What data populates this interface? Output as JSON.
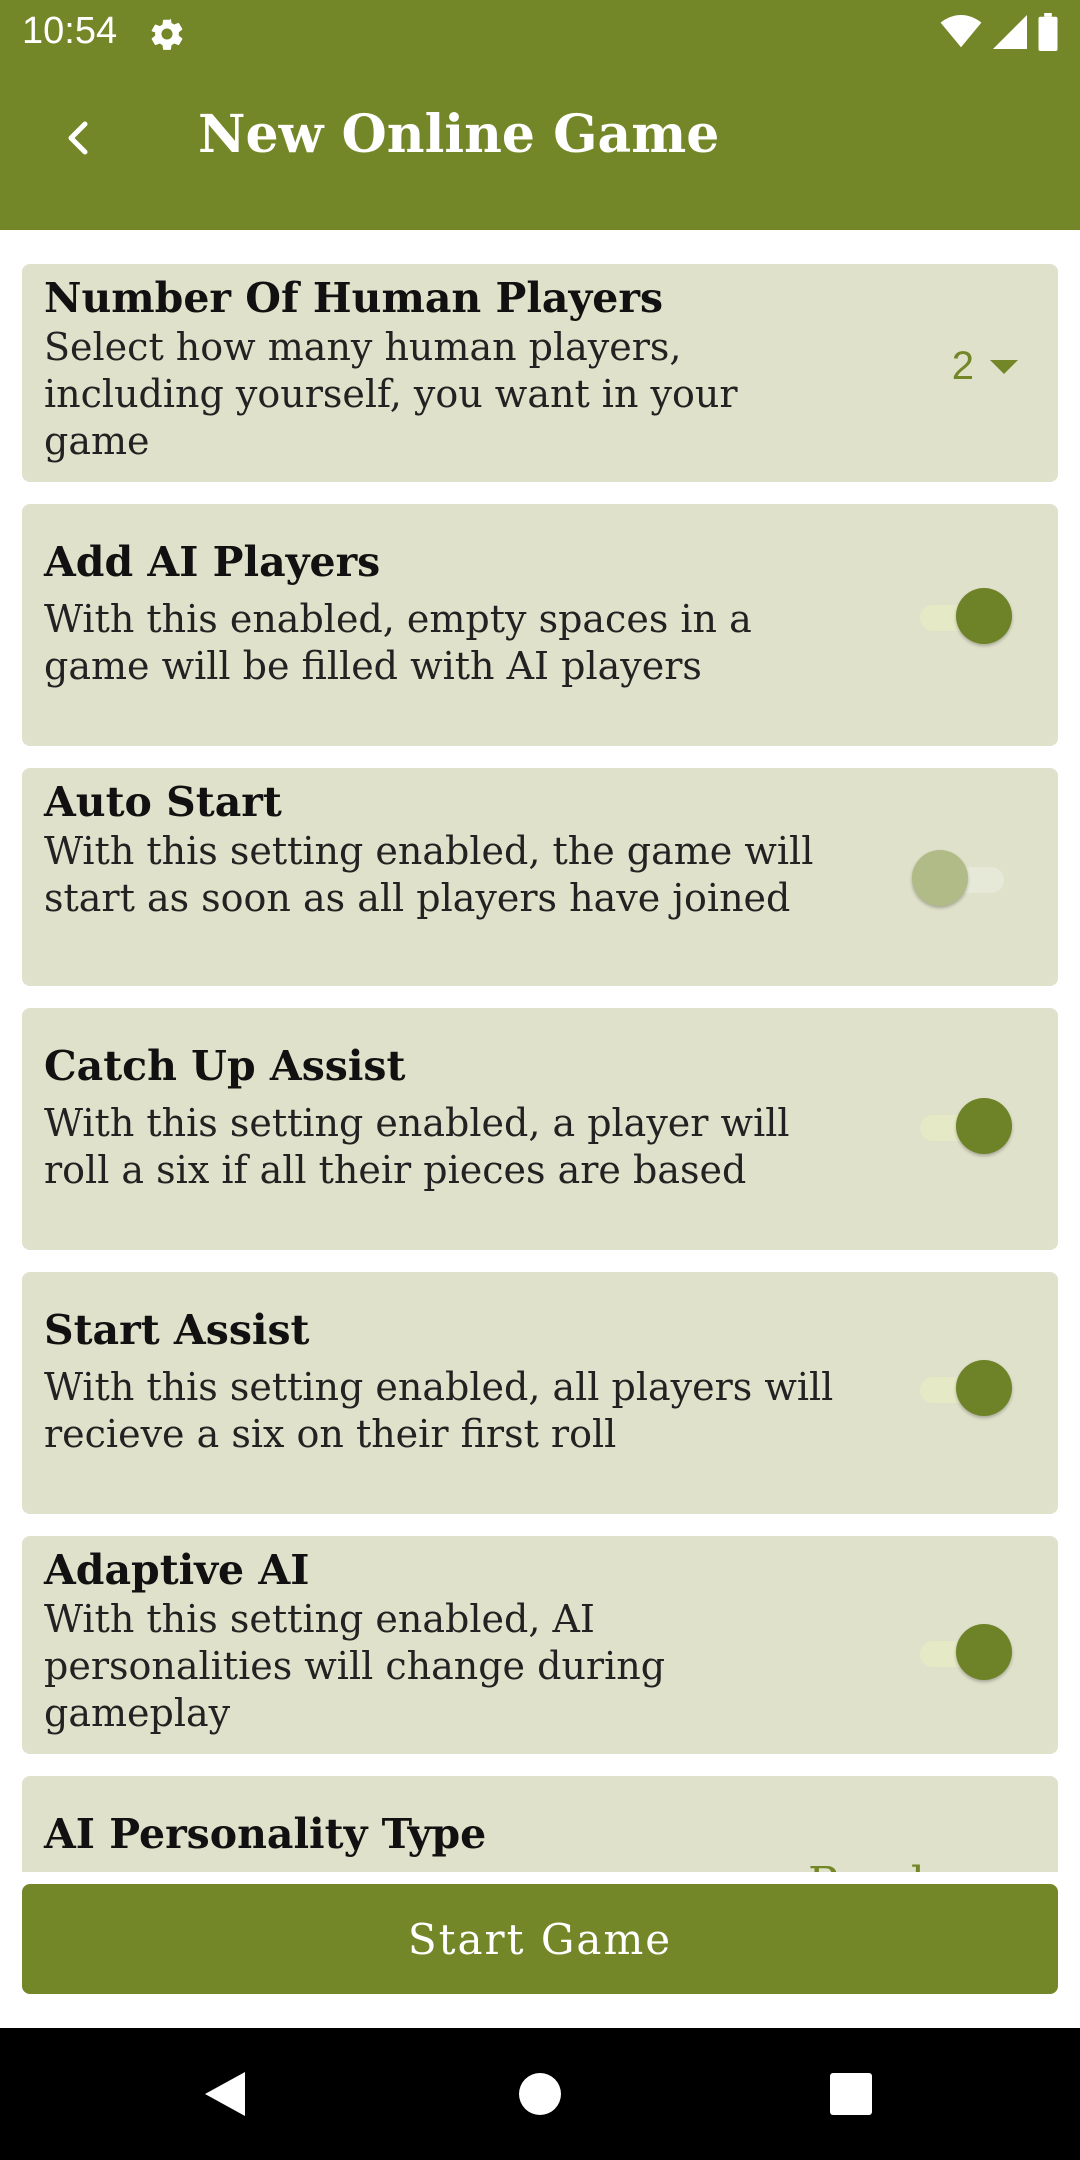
{
  "status_bar": {
    "time": "10:54",
    "icons": [
      "settings-gear-icon",
      "wifi-icon",
      "cellular-signal-icon",
      "battery-icon"
    ]
  },
  "app_bar": {
    "title": "New Online Game",
    "back_icon": "chevron-left-icon",
    "color": "#738728"
  },
  "settings": {
    "human_players": {
      "title": "Number Of Human Players",
      "description": "Select how many human players, including yourself, you want in your game",
      "value": "2"
    },
    "add_ai": {
      "title": "Add AI Players",
      "description": "With this enabled, empty spaces in a game will be filled with AI players",
      "enabled": true
    },
    "auto_start": {
      "title": "Auto Start",
      "description": "With this setting enabled, the game will start as soon as all players have joined",
      "enabled": false
    },
    "catch_up": {
      "title": "Catch Up Assist",
      "description": "With this setting enabled, a player will roll a six if all their pieces are based",
      "enabled": true
    },
    "start_assist": {
      "title": "Start Assist",
      "description": "With this setting enabled, all players will recieve a six on their first roll",
      "enabled": true
    },
    "adaptive_ai": {
      "title": "Adaptive AI",
      "description": "With this setting enabled, AI personalities will change during gameplay",
      "enabled": true
    },
    "ai_personality": {
      "title": "AI Personality Type",
      "value": "Random"
    }
  },
  "actions": {
    "start_game": "Start Game"
  },
  "colors": {
    "accent": "#738728",
    "card_background": "#dfe1ca"
  }
}
